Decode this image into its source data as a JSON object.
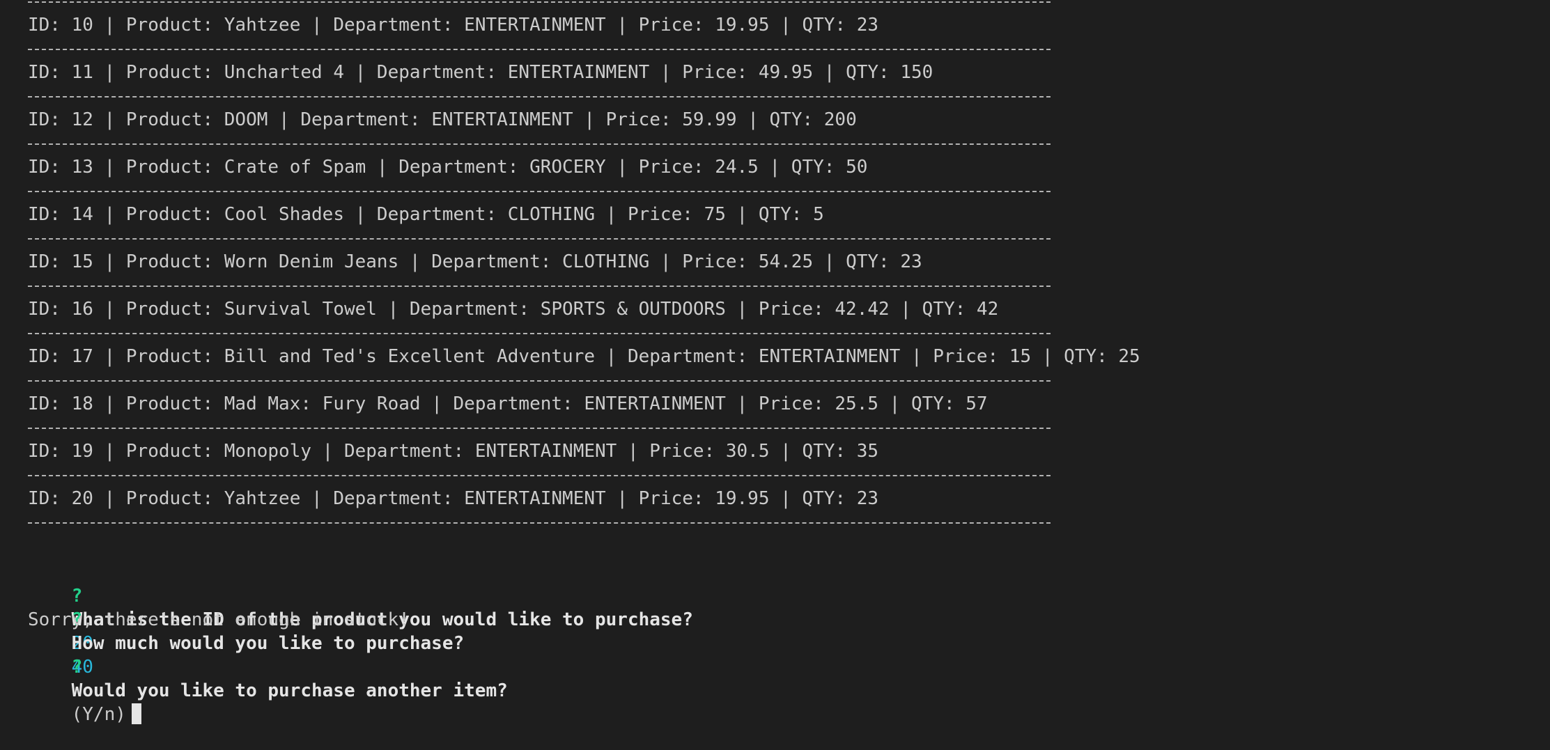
{
  "products": [
    {
      "id": "10",
      "name": "Yahtzee",
      "department": "ENTERTAINMENT",
      "price": "19.95",
      "qty": "23"
    },
    {
      "id": "11",
      "name": "Uncharted 4",
      "department": "ENTERTAINMENT",
      "price": "49.95",
      "qty": "150"
    },
    {
      "id": "12",
      "name": "DOOM",
      "department": "ENTERTAINMENT",
      "price": "59.99",
      "qty": "200"
    },
    {
      "id": "13",
      "name": "Crate of Spam",
      "department": "GROCERY",
      "price": "24.5",
      "qty": "50"
    },
    {
      "id": "14",
      "name": "Cool Shades",
      "department": "CLOTHING",
      "price": "75",
      "qty": "5"
    },
    {
      "id": "15",
      "name": "Worn Denim Jeans",
      "department": "CLOTHING",
      "price": "54.25",
      "qty": "23"
    },
    {
      "id": "16",
      "name": "Survival Towel",
      "department": "SPORTS & OUTDOORS",
      "price": "42.42",
      "qty": "42"
    },
    {
      "id": "17",
      "name": "Bill and Ted's Excellent Adventure",
      "department": "ENTERTAINMENT",
      "price": "15",
      "qty": "25"
    },
    {
      "id": "18",
      "name": "Mad Max: Fury Road",
      "department": "ENTERTAINMENT",
      "price": "25.5",
      "qty": "57"
    },
    {
      "id": "19",
      "name": "Monopoly",
      "department": "ENTERTAINMENT",
      "price": "30.5",
      "qty": "35"
    },
    {
      "id": "20",
      "name": "Yahtzee",
      "department": "ENTERTAINMENT",
      "price": "19.95",
      "qty": "23"
    }
  ],
  "labels": {
    "id": "ID: ",
    "product": " | Product: ",
    "department": " | Department: ",
    "price": " | Price: ",
    "qty": " | QTY: "
  },
  "prompts": {
    "marker": "?",
    "id_question": "What is the ID of the product you would like to purchase?",
    "id_answer": "20",
    "qty_question": "How much would you like to purchase?",
    "qty_answer": "40",
    "stock_message": "Sorry, there's not enough in stock!",
    "again_question": "Would you like to purchase another item?",
    "again_hint": "(Y/n)"
  },
  "colors": {
    "background": "#1e1e1e",
    "text": "#cccccc",
    "prompt_marker": "#23d18b",
    "answer": "#29b8db"
  }
}
